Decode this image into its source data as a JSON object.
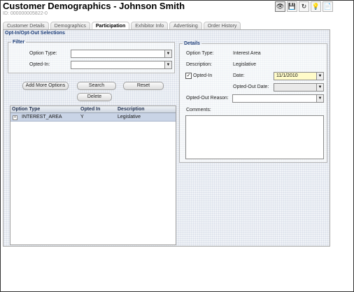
{
  "header": {
    "title": "Customer Demographics - Johnson Smith",
    "id_label": "ID: 000000005822-0"
  },
  "toolbar": {
    "icons": [
      "eye-icon",
      "save-icon",
      "refresh-icon",
      "lightbulb-icon",
      "report-icon"
    ],
    "glyphs": [
      "👁",
      "💾",
      "↻",
      "💡",
      "📄"
    ]
  },
  "tabs": [
    {
      "label": "Customer Details"
    },
    {
      "label": "Demographics"
    },
    {
      "label": "Participation",
      "active": true
    },
    {
      "label": "Exhibitor Info"
    },
    {
      "label": "Advertising"
    },
    {
      "label": "Order History"
    }
  ],
  "section": {
    "title": "Opt-In/Opt-Out Selections"
  },
  "filter": {
    "legend": "Filter",
    "option_type_label": "Option Type:",
    "option_type_value": "",
    "opted_in_label": "Opted-In:",
    "opted_in_value": ""
  },
  "buttons": {
    "add_more_options": "Add More Options",
    "search": "Search",
    "reset": "Reset",
    "delete": "Delete"
  },
  "grid": {
    "columns": [
      "Option Type",
      "Opted In",
      "Description"
    ],
    "rows": [
      {
        "option_type": "INTEREST_AREA",
        "opted_in": "Y",
        "description": "Legislative",
        "expander": "+"
      }
    ]
  },
  "details": {
    "legend": "Details",
    "option_type_label": "Option Type:",
    "option_type_value": "Interest Area",
    "description_label": "Description:",
    "description_value": "Legislative",
    "opted_in_label": "Opted-In",
    "opted_in_checked": true,
    "check_glyph": "✓",
    "date_label": "Date:",
    "date_value": "11/1/2010",
    "opted_out_date_label": "Opted-Out Date:",
    "opted_out_date_value": "",
    "opted_out_reason_label": "Opted-Out Reason:",
    "opted_out_reason_value": "",
    "comments_label": "Comments:",
    "comments_value": ""
  },
  "dropdown_arrow": "▼",
  "colors": {
    "section_title": "#1f3f7a",
    "date_field_bg": "#fffbc9",
    "selected_row_bg": "#c9d4e6"
  }
}
